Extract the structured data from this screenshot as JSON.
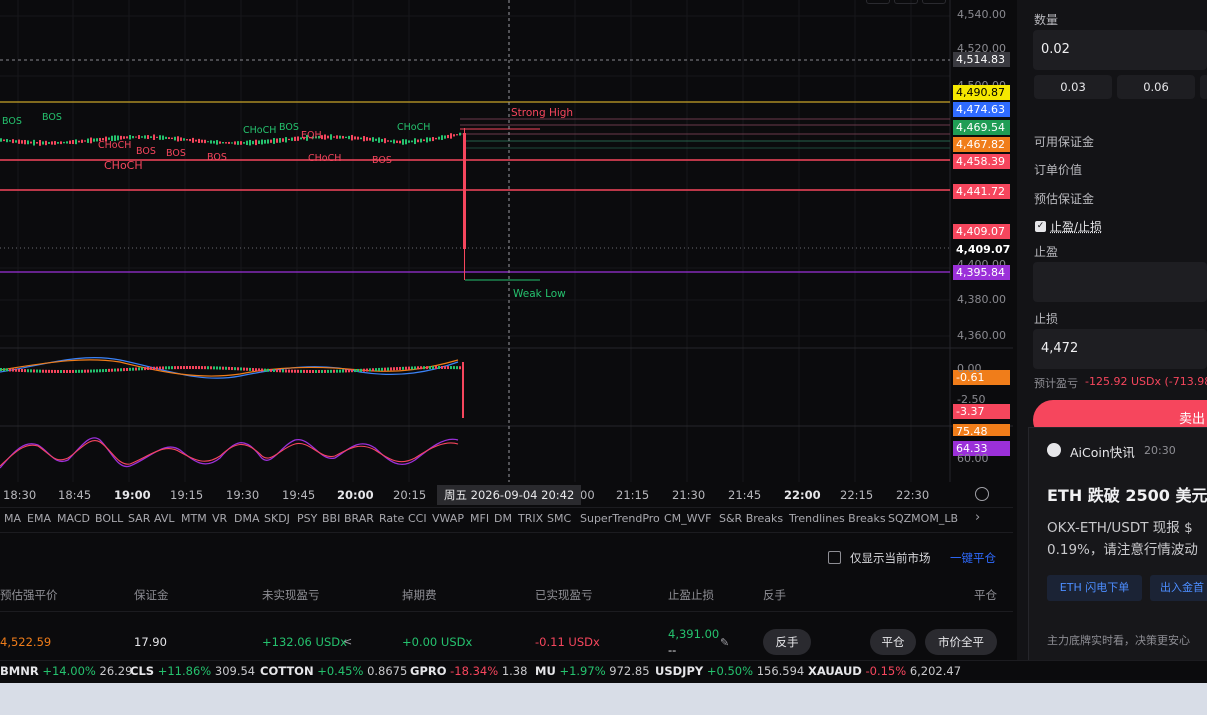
{
  "price_axis": {
    "levels": [
      "4,540.00",
      "4,520.00",
      "4,500.00",
      "4,400.00",
      "4,380.00",
      "4,360.00"
    ],
    "tags": [
      {
        "label": "4,514.83",
        "bg": "#3a3a40",
        "fg": "#ffffff"
      },
      {
        "label": "4,490.87",
        "bg": "#f5e800",
        "fg": "#000000"
      },
      {
        "label": "4,474.63",
        "bg": "#2f6bff",
        "fg": "#ffffff"
      },
      {
        "label": "4,469.54",
        "bg": "#1f9d55",
        "fg": "#ffffff"
      },
      {
        "label": "4,467.82",
        "bg": "#f07d1a",
        "fg": "#ffffff"
      },
      {
        "label": "4,458.39",
        "bg": "#f6465d",
        "fg": "#ffffff"
      },
      {
        "label": "4,441.72",
        "bg": "#f6465d",
        "fg": "#ffffff"
      },
      {
        "label": "4,409.07",
        "bg": "#f6465d",
        "fg": "#ffffff"
      },
      {
        "label": "4,409.07",
        "bg": "transparent",
        "fg": "#ffffff"
      },
      {
        "label": "4,395.84",
        "bg": "#9b30d9",
        "fg": "#ffffff"
      }
    ],
    "sub_levels": [
      "0.00",
      "-2.50",
      "75.48",
      "60.00"
    ],
    "sub_tags": [
      {
        "label": "-0.61",
        "bg": "#f07d1a",
        "fg": "#ffffff"
      },
      {
        "label": "-3.37",
        "bg": "#f6465d",
        "fg": "#ffffff"
      },
      {
        "label": "75.48",
        "bg": "#f07d1a",
        "fg": "#ffffff"
      },
      {
        "label": "64.33",
        "bg": "#9b30d9",
        "fg": "#ffffff"
      }
    ]
  },
  "annotations": {
    "bos": "BOS",
    "choch": "CHoCH",
    "eqh": "EQH",
    "strong_high": "Strong High",
    "weak_low": "Weak Low"
  },
  "time_axis": {
    "labels": [
      "18:30",
      "18:45",
      "19:00",
      "19:15",
      "19:30",
      "19:45",
      "20:00",
      "20:15",
      "00",
      "21:15",
      "21:30",
      "21:45",
      "22:00",
      "22:15",
      "22:30"
    ],
    "cursor": "周五 2026-09-04   20:42"
  },
  "indicators": [
    "MA",
    "EMA",
    "MACD",
    "BOLL",
    "SAR",
    "AVL",
    "MTM",
    "VR",
    "DMA",
    "SKDJ",
    "PSY",
    "BBI",
    "BRAR",
    "Rate",
    "CCI",
    "VWAP",
    "MFI",
    "DM",
    "TRIX",
    "SMC",
    "SuperTrendPro",
    "CM_WVF",
    "S&R Breaks",
    "Trendlines Breaks",
    "SQZMOM_LB"
  ],
  "positions": {
    "only_current_label": "仅显示当前市场",
    "close_all_label": "一键平仓",
    "headers": [
      "预估强平价",
      "保证金",
      "未实现盈亏",
      "掉期费",
      "已实现盈亏",
      "止盈止损",
      "反手",
      "平仓"
    ],
    "row": {
      "liq_price": "4,522.59",
      "margin": "17.90",
      "unrealized": "+132.06 USDx",
      "swap": "+0.00 USDx",
      "realized": "-0.11 USDx",
      "tp": "4,391.00",
      "sl": "--",
      "reverse_btn": "反手",
      "close_btn": "平仓",
      "market_close_btn": "市价全平"
    }
  },
  "ticker": [
    {
      "name": "BMNR",
      "change": "+14.00%",
      "price": "26.29",
      "dir": "up"
    },
    {
      "name": "CLS",
      "change": "+11.86%",
      "price": "309.54",
      "dir": "up"
    },
    {
      "name": "COTTON",
      "change": "+0.45%",
      "price": "0.8675",
      "dir": "up"
    },
    {
      "name": "GPRO",
      "change": "-18.34%",
      "price": "1.38",
      "dir": "down"
    },
    {
      "name": "MU",
      "change": "+1.97%",
      "price": "972.85",
      "dir": "up"
    },
    {
      "name": "USDJPY",
      "change": "+0.50%",
      "price": "156.594",
      "dir": "up"
    },
    {
      "name": "XAUAUD",
      "change": "-0.15%",
      "price": "6,202.47",
      "dir": "down"
    }
  ],
  "order_panel": {
    "qty_label": "数量",
    "qty_value": "0.02",
    "qty_chips": [
      "0.03",
      "0.06"
    ],
    "avail_margin": "可用保证金",
    "order_value": "订单价值",
    "est_margin": "预估保证金",
    "tpsl_label": "止盈/止损",
    "tp_label": "止盈",
    "sl_label": "止损",
    "sl_value": "4,472",
    "est_pnl_label": "预计盈亏",
    "est_pnl_value": "-125.92 USDx (-713.98",
    "submit": "卖出"
  },
  "news": {
    "source": "AiCoin快讯",
    "time": "20:30",
    "headline": "ETH 跌破 2500 美元",
    "body1": "OKX-ETH/USDT 现报 $",
    "body2": "0.19%，请注意行情波动",
    "btn1": "ETH 闪电下单",
    "btn2": "出入金首",
    "footer": "主力底牌实时看，决策更安心"
  },
  "colors": {
    "up": "#25c26e",
    "down": "#f6465d",
    "accent": "#2f6bff"
  }
}
